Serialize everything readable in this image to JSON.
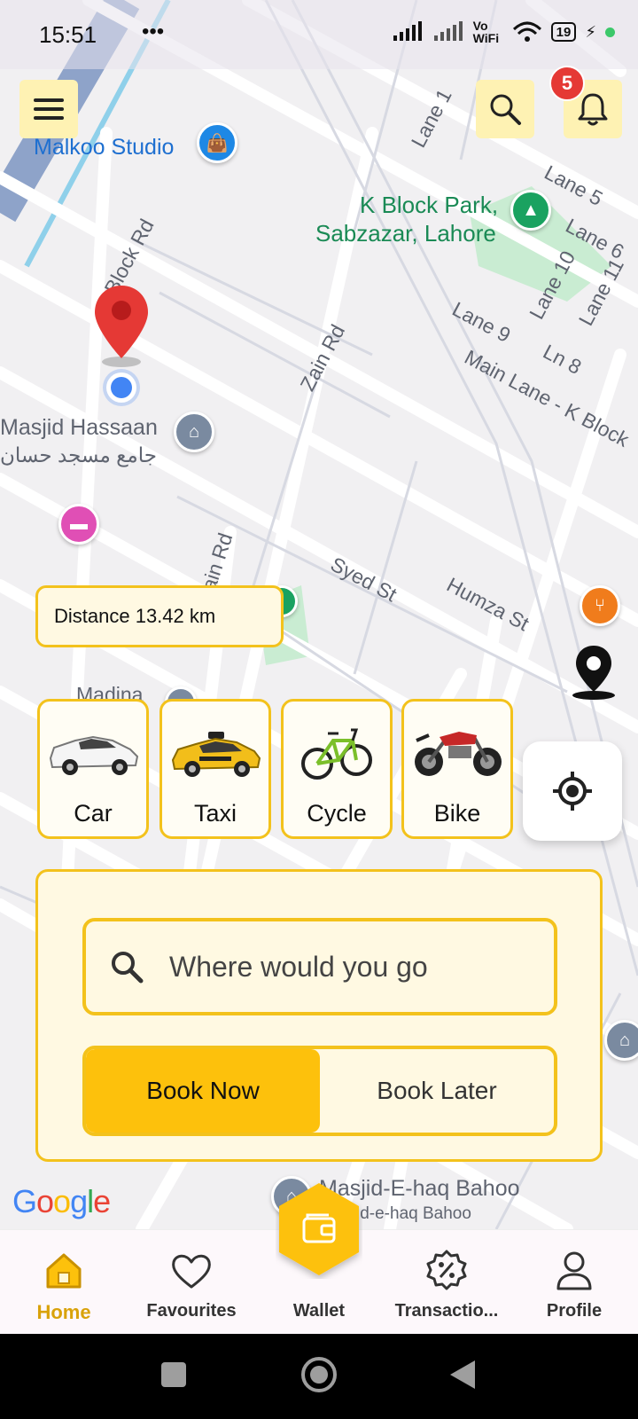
{
  "status_bar": {
    "time": "15:51",
    "extra": "•••",
    "network": "Vo WiFi",
    "battery": "19"
  },
  "top_bar": {
    "notification_count": "5"
  },
  "map": {
    "labels": [
      "Malkoo Studio",
      "K Block Park,",
      "Sabzazar, Lahore",
      "Lane 1",
      "Lane 5",
      "Lane 6",
      "Lane 9",
      "Lane 10",
      "Lane 11",
      "Ln 8",
      "Main Lane - K Block",
      "Block Rd",
      "Zain Rd",
      "Masjid Hassaan",
      "جامع مسجد حسان",
      "Syed St",
      "Humza St",
      "ain Rd",
      "Madina",
      "Masjid-E-haq Bahoo",
      "id-e-haq Bahoo"
    ]
  },
  "distance": {
    "text": "Distance 13.42 km"
  },
  "vehicles": [
    {
      "label": "Car"
    },
    {
      "label": "Taxi"
    },
    {
      "label": "Cycle"
    },
    {
      "label": "Bike"
    }
  ],
  "booking": {
    "search_placeholder": "Where would you go",
    "book_now": "Book Now",
    "book_later": "Book Later"
  },
  "google_logo": "Google",
  "bottom_nav": {
    "items": [
      {
        "label": "Home",
        "icon": "home-icon",
        "active": true
      },
      {
        "label": "Favourites",
        "icon": "heart-icon"
      },
      {
        "label": "Wallet",
        "icon": "wallet-icon"
      },
      {
        "label": "Transactio...",
        "icon": "percent-badge-icon"
      },
      {
        "label": "Profile",
        "icon": "person-icon"
      }
    ]
  },
  "colors": {
    "accent": "#fdc10c",
    "accent_border": "#f3c21c",
    "panel_bg": "#fff9e2",
    "badge": "#e53935",
    "pin": "#e53935",
    "my_location": "#4285f4"
  }
}
